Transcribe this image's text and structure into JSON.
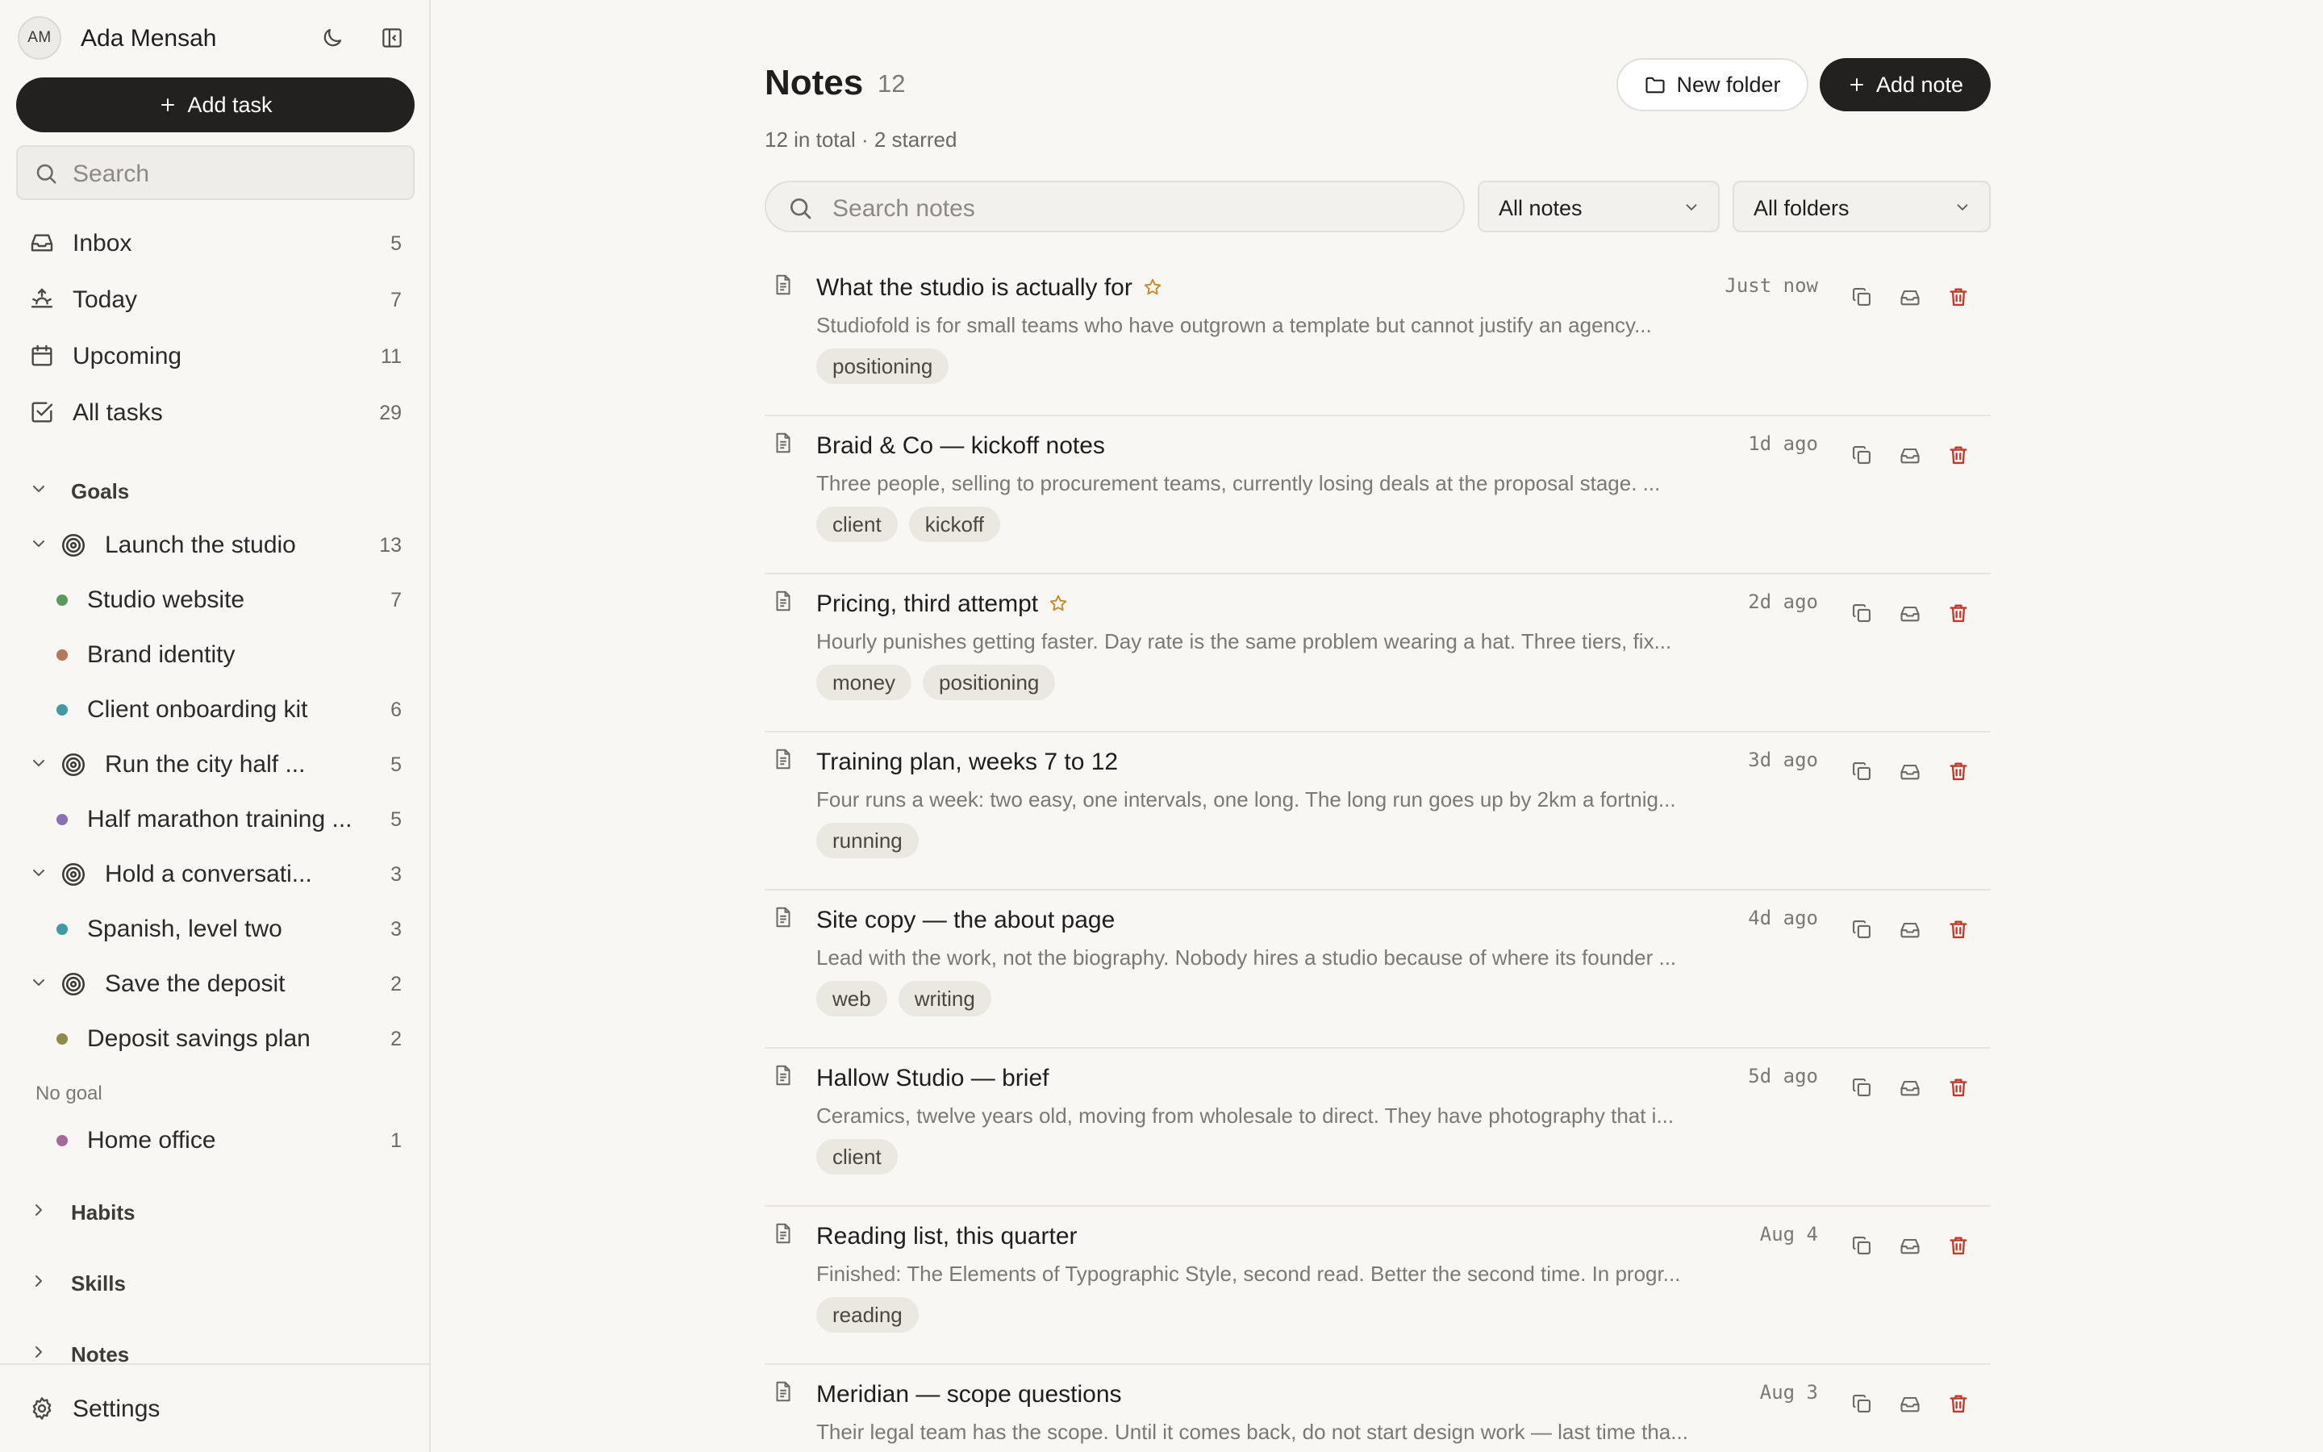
{
  "user": {
    "initials": "AM",
    "name": "Ada Mensah"
  },
  "sidebar": {
    "add_task_label": "Add task",
    "search_placeholder": "Search",
    "nav": [
      {
        "label": "Inbox",
        "count": "5",
        "icon": "inbox-icon"
      },
      {
        "label": "Today",
        "count": "7",
        "icon": "sunrise-icon"
      },
      {
        "label": "Upcoming",
        "count": "11",
        "icon": "calendar-icon"
      },
      {
        "label": "All tasks",
        "count": "29",
        "icon": "checkbox-icon"
      }
    ],
    "goals_heading": "Goals",
    "goals": [
      {
        "label": "Launch the studio",
        "count": "13"
      },
      {
        "label": "Run the city half ...",
        "count": "5"
      },
      {
        "label": "Hold a conversati...",
        "count": "3"
      },
      {
        "label": "Save the deposit",
        "count": "2"
      }
    ],
    "projects": [
      {
        "label": "Studio website",
        "count": "7",
        "color": "#5a9a5e"
      },
      {
        "label": "Brand identity",
        "count": "",
        "color": "#b5785a"
      },
      {
        "label": "Client onboarding kit",
        "count": "6",
        "color": "#3f9aa3"
      },
      {
        "label": "Half marathon training ...",
        "count": "5",
        "color": "#8b6fb8"
      },
      {
        "label": "Spanish, level two",
        "count": "3",
        "color": "#3f9aa3"
      },
      {
        "label": "Deposit savings plan",
        "count": "2",
        "color": "#8f8a4a"
      },
      {
        "label": "Home office",
        "count": "1",
        "color": "#a56a9a"
      }
    ],
    "no_goal_label": "No goal",
    "habits_heading": "Habits",
    "skills_heading": "Skills",
    "notes_heading": "Notes",
    "settings_label": "Settings"
  },
  "main": {
    "title": "Notes",
    "title_count": "12",
    "subtitle": "12 in total · 2 starred",
    "new_folder_label": "New folder",
    "add_note_label": "Add note",
    "search_placeholder": "Search notes",
    "filter_notes": "All notes",
    "filter_folders": "All folders",
    "notes": [
      {
        "title": "What the studio is actually for",
        "starred": true,
        "time": "Just now",
        "excerpt": "Studiofold is for small teams who have outgrown a template but cannot justify an agency...",
        "tags": [
          "positioning"
        ]
      },
      {
        "title": "Braid & Co — kickoff notes",
        "starred": false,
        "time": "1d ago",
        "excerpt": "Three people, selling to procurement teams, currently losing deals at the proposal stage. ...",
        "tags": [
          "client",
          "kickoff"
        ]
      },
      {
        "title": "Pricing, third attempt",
        "starred": true,
        "time": "2d ago",
        "excerpt": "Hourly punishes getting faster. Day rate is the same problem wearing a hat. Three tiers, fix...",
        "tags": [
          "money",
          "positioning"
        ]
      },
      {
        "title": "Training plan, weeks 7 to 12",
        "starred": false,
        "time": "3d ago",
        "excerpt": "Four runs a week: two easy, one intervals, one long. The long run goes up by 2km a fortnig...",
        "tags": [
          "running"
        ]
      },
      {
        "title": "Site copy — the about page",
        "starred": false,
        "time": "4d ago",
        "excerpt": "Lead with the work, not the biography. Nobody hires a studio because of where its founder ...",
        "tags": [
          "web",
          "writing"
        ]
      },
      {
        "title": "Hallow Studio — brief",
        "starred": false,
        "time": "5d ago",
        "excerpt": "Ceramics, twelve years old, moving from wholesale to direct. They have photography that i...",
        "tags": [
          "client"
        ]
      },
      {
        "title": "Reading list, this quarter",
        "starred": false,
        "time": "Aug 4",
        "excerpt": "Finished: The Elements of Typographic Style, second read. Better the second time. In progr...",
        "tags": [
          "reading"
        ]
      },
      {
        "title": "Meridian — scope questions",
        "starred": false,
        "time": "Aug 3",
        "excerpt": "Their legal team has the scope. Until it comes back, do not start design work — last time tha...",
        "tags": []
      }
    ]
  }
}
